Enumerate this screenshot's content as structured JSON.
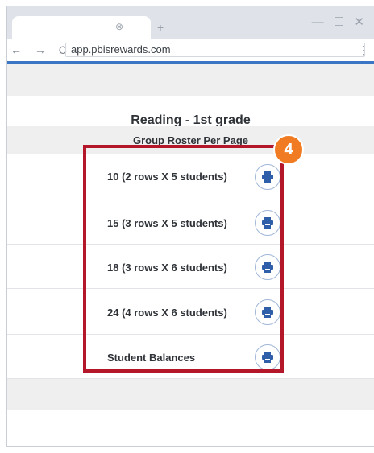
{
  "browser": {
    "url": "app.pbisrewards.com",
    "tab_close_icon": "⊗",
    "new_tab_icon": "+",
    "window_controls": "— ☐ ✕",
    "nav_icons": "← → C",
    "menu_icon": "⋮"
  },
  "page": {
    "title": "Reading - 1st grade",
    "section_header": "Group Roster Per Page",
    "options": [
      {
        "label": "10 (2 rows X 5 students)",
        "icon": "print-icon"
      },
      {
        "label": "15 (3 rows X 5 students)",
        "icon": "print-icon"
      },
      {
        "label": "18 (3 rows X 6 students)",
        "icon": "print-icon"
      },
      {
        "label": "24 (4 rows X 6 students)",
        "icon": "print-icon"
      },
      {
        "label": "Student Balances",
        "icon": "print-icon"
      }
    ]
  },
  "annotation": {
    "step_number": "4",
    "highlight_color": "#b5172a",
    "badge_color": "#f07b22"
  },
  "colors": {
    "accent": "#3b76c4",
    "icon_blue": "#2f5fa8"
  }
}
